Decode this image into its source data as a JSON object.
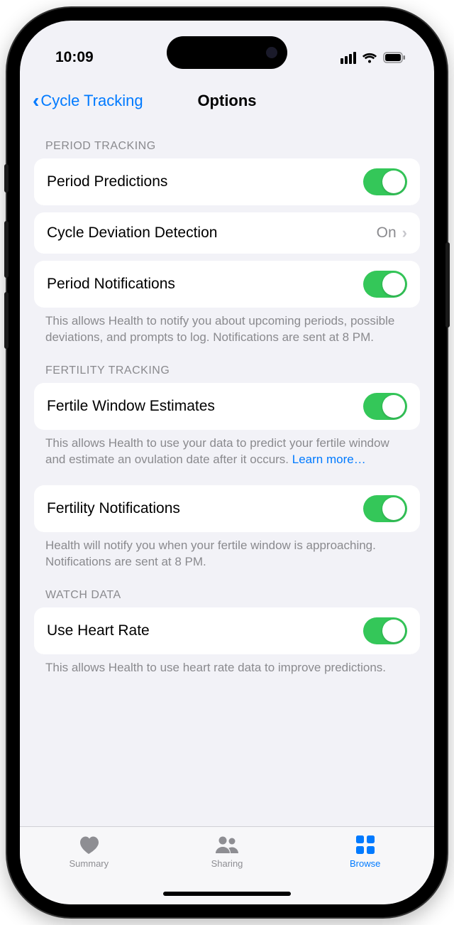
{
  "statusBar": {
    "time": "10:09"
  },
  "nav": {
    "back": "Cycle Tracking",
    "title": "Options"
  },
  "sections": {
    "period": {
      "header": "PERIOD TRACKING",
      "predictions": "Period Predictions",
      "deviation": {
        "label": "Cycle Deviation Detection",
        "value": "On"
      },
      "notifications": "Period Notifications",
      "footer": "This allows Health to notify you about upcoming periods, possible deviations, and prompts to log. Notifications are sent at 8 PM."
    },
    "fertility": {
      "header": "FERTILITY TRACKING",
      "estimates": "Fertile Window Estimates",
      "estimatesFooter": "This allows Health to use your data to predict your fertile window and estimate an ovulation date after it occurs. ",
      "learnMore": "Learn more…",
      "notifications": "Fertility Notifications",
      "notificationsFooter": "Health will notify you when your fertile window is approaching. Notifications are sent at 8 PM."
    },
    "watch": {
      "header": "WATCH DATA",
      "heartRate": "Use Heart Rate",
      "footer": "This allows Health to use heart rate data to improve predictions."
    }
  },
  "tabs": {
    "summary": "Summary",
    "sharing": "Sharing",
    "browse": "Browse"
  }
}
